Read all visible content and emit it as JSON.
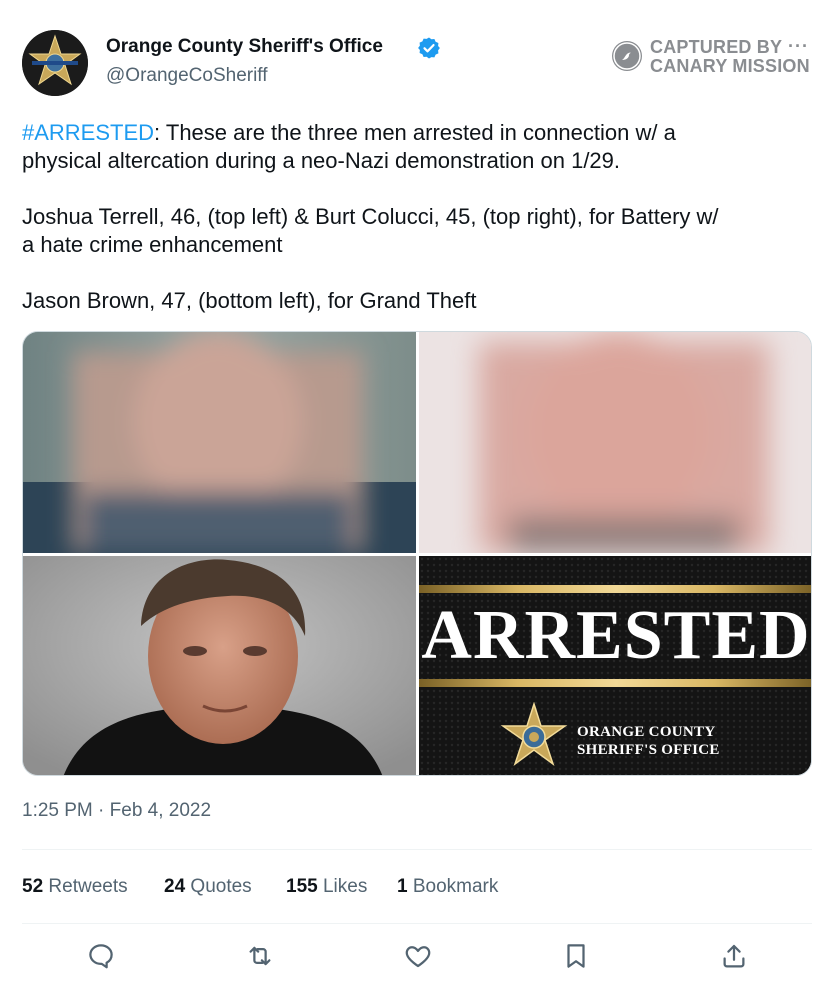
{
  "author": {
    "display_name": "Orange County Sheriff's Office",
    "handle": "@OrangeCoSheriff",
    "verified": true,
    "avatar_icon": "sheriff-star-icon"
  },
  "watermark": {
    "line1": "CAPTURED BY",
    "line2": "CANARY MISSION",
    "more_label": "···"
  },
  "tweet": {
    "hashtag": "#ARRESTED",
    "line1_rest": ": These are the three men arrested in connection w/ a",
    "line2": "physical altercation during a neo-Nazi demonstration on 1/29.",
    "para2_line1": "Joshua Terrell, 46, (top left) & Burt Colucci, 45, (top right), for Battery w/",
    "para2_line2": "a hate crime enhancement",
    "para3": "Jason Brown, 47, (bottom left), for Grand Theft"
  },
  "media": {
    "graphic_word": "ARRESTED",
    "graphic_org_line1": "ORANGE COUNTY",
    "graphic_org_line2": "SHERIFF'S OFFICE"
  },
  "timestamp": "1:25 PM · Feb 4, 2022",
  "stats": {
    "retweets_count": "52",
    "retweets_label": "Retweets",
    "quotes_count": "24",
    "quotes_label": "Quotes",
    "likes_count": "155",
    "likes_label": "Likes",
    "bookmarks_count": "1",
    "bookmarks_label": "Bookmark"
  },
  "actions": [
    "reply-icon",
    "retweet-icon",
    "like-icon",
    "bookmark-icon",
    "share-icon"
  ],
  "colors": {
    "link": "#1d9bf0",
    "secondary_text": "#536471",
    "verified": "#1d9bf0",
    "gold": "#d9b764"
  }
}
